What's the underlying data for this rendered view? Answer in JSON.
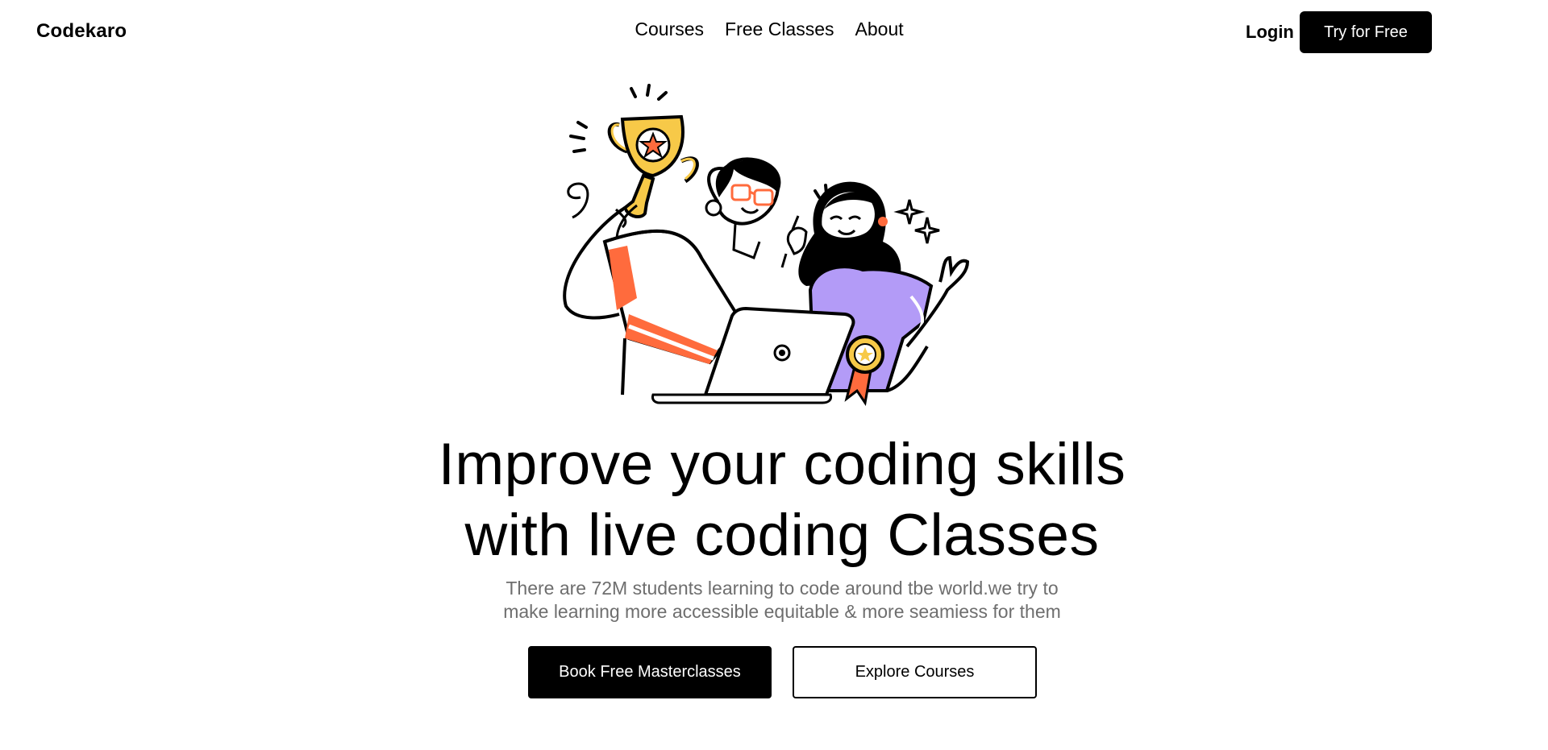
{
  "brand": {
    "name": "Codekaro"
  },
  "nav": {
    "items": [
      {
        "label": "Courses"
      },
      {
        "label": "Free Classes"
      },
      {
        "label": "About"
      }
    ]
  },
  "header_actions": {
    "login_label": "Login",
    "try_label": "Try for Free"
  },
  "hero": {
    "title_line1": "Improve your coding skills",
    "title_line2": "with live coding Classes",
    "subtitle_line1": "There are 72M students learning to code around tbe world.we try to",
    "subtitle_line2": "make learning more accessible equitable & more seamiess for them",
    "primary_cta": "Book Free Masterclasses",
    "secondary_cta": "Explore Courses"
  },
  "illustration": {
    "icons": [
      "trophy-icon",
      "medal-icon",
      "laptop-icon",
      "sparkle-icon"
    ],
    "colors": {
      "orange": "#FF6B3D",
      "yellow": "#F7C948",
      "purple": "#B39BF7",
      "black": "#000000"
    }
  }
}
